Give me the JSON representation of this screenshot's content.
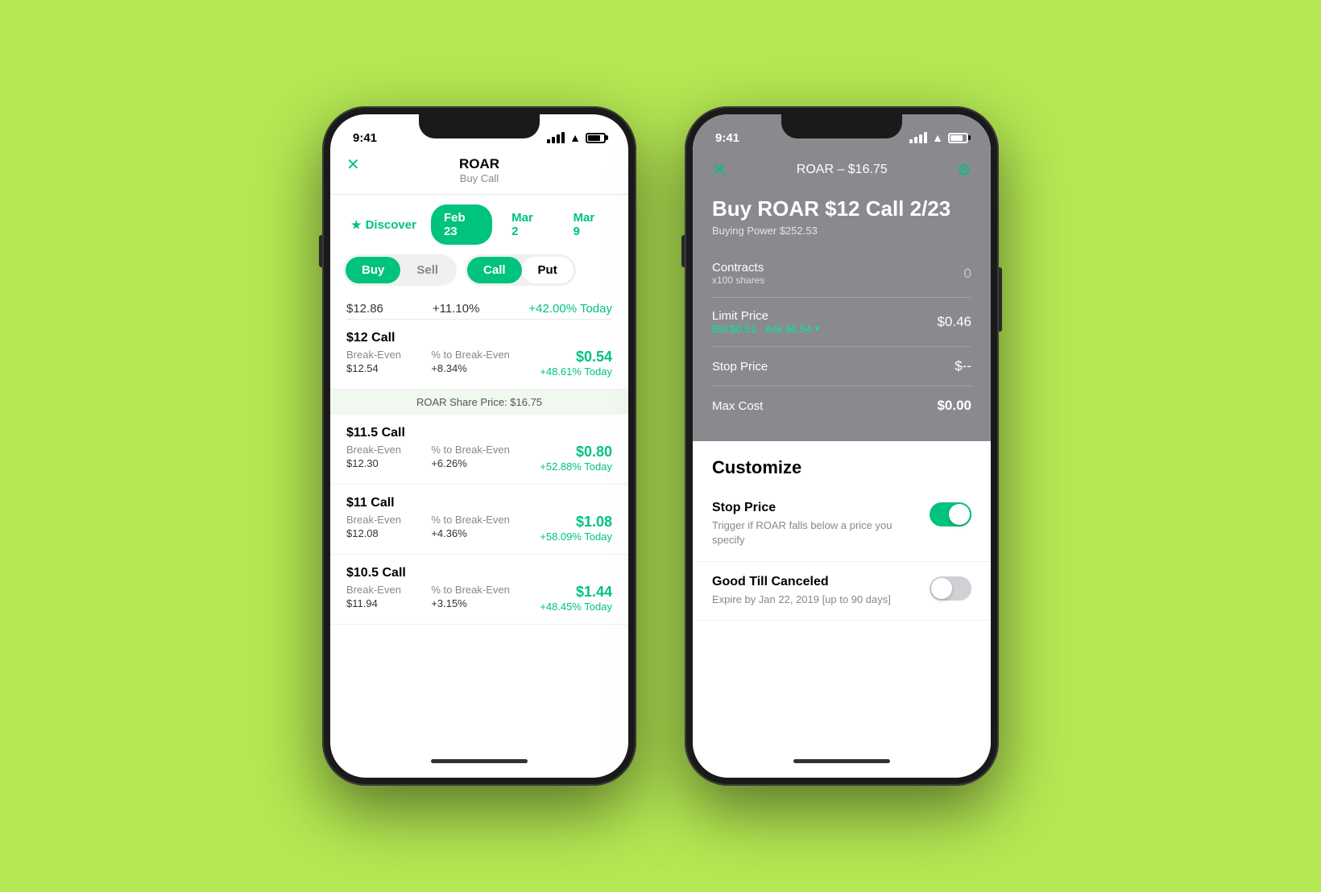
{
  "background_color": "#b5e853",
  "phone1": {
    "status_bar": {
      "time": "9:41"
    },
    "header": {
      "ticker": "ROAR",
      "subtitle": "Buy Call",
      "close_label": "✕"
    },
    "expiry_tabs": [
      {
        "label": "Discover",
        "active": false,
        "has_star": true
      },
      {
        "label": "Feb 23",
        "active": true
      },
      {
        "label": "Mar 2",
        "active": false
      },
      {
        "label": "Mar 9",
        "active": false
      }
    ],
    "action_toggles": {
      "buy_sell": [
        {
          "label": "Buy",
          "active": true
        },
        {
          "label": "Sell",
          "active": false
        }
      ],
      "call_put": [
        {
          "label": "Call",
          "active": true
        },
        {
          "label": "Put",
          "active": false
        }
      ]
    },
    "price_row": {
      "price": "$12.86",
      "pct": "+11.10%",
      "today": "+42.00% Today"
    },
    "share_price_banner": "ROAR Share Price: $16.75",
    "options": [
      {
        "title": "$12 Call",
        "break_even_label": "Break-Even",
        "break_even_val": "$12.54",
        "pct_label": "% to Break-Even",
        "pct_val": "+8.34%",
        "price": "$0.54",
        "today": "+48.61% Today"
      },
      {
        "title": "$11.5 Call",
        "break_even_label": "Break-Even",
        "break_even_val": "$12.30",
        "pct_label": "% to Break-Even",
        "pct_val": "+6.26%",
        "price": "$0.80",
        "today": "+52.88% Today"
      },
      {
        "title": "$11 Call",
        "break_even_label": "Break-Even",
        "break_even_val": "$12.08",
        "pct_label": "% to Break-Even",
        "pct_val": "+4.36%",
        "price": "$1.08",
        "today": "+58.09% Today"
      },
      {
        "title": "$10.5 Call",
        "break_even_label": "Break-Even",
        "break_even_val": "$11.94",
        "pct_label": "% to Break-Even",
        "pct_val": "+3.15%",
        "price": "$1.44",
        "today": "+48.45% Today"
      }
    ]
  },
  "phone2": {
    "status_bar": {
      "time": "9:41"
    },
    "header": {
      "close_label": "✕",
      "title": "ROAR – $16.75",
      "gear_label": "⚙"
    },
    "buy_title": "Buy ROAR $12 Call 2/23",
    "buying_power": "Buying Power $252.53",
    "fields": [
      {
        "label": "Contracts",
        "sublabel": "x100 shares",
        "value": "0",
        "is_placeholder": true
      },
      {
        "label": "Limit Price",
        "bid_ask": "Bid $0.51 · Ask $0.54",
        "value": "$0.46",
        "is_placeholder": false
      },
      {
        "label": "Stop Price",
        "sublabel": "",
        "value": "$--",
        "is_placeholder": false
      },
      {
        "label": "Max Cost",
        "sublabel": "",
        "value": "$0.00",
        "is_bold": true
      }
    ],
    "customize": {
      "title": "Customize",
      "items": [
        {
          "label": "Stop Price",
          "sublabel": "Trigger if ROAR falls below a price you specify",
          "toggle_on": true
        },
        {
          "label": "Good Till Canceled",
          "sublabel": "Expire by Jan 22, 2019 [up to 90 days]",
          "toggle_on": false
        }
      ]
    }
  }
}
